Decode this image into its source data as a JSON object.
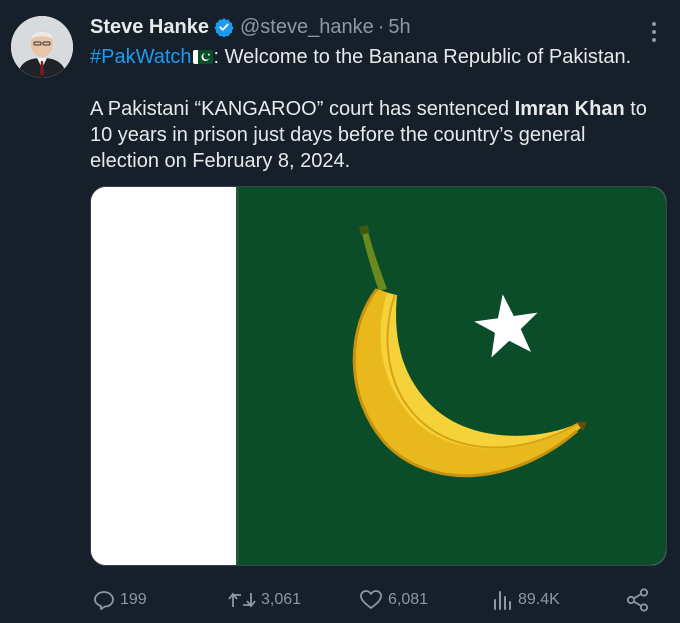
{
  "author": {
    "display_name": "Steve Hanke",
    "handle": "@steve_hanke",
    "separator": "·",
    "time_ago": "5h",
    "verified": true,
    "verified_color": "#1d9bf0"
  },
  "tweet": {
    "hashtag": "#PakWatch",
    "line1_after_flag": ": Welcome to the Banana Republic of Pakistan.",
    "line2_a": "A Pakistani “KANGAROO” court has sentenced ",
    "line2_bold": "Imran Khan",
    "line2_b": " to",
    "line3": "10 years in prison just days before the country’s general",
    "line4": "election on February 8, 2024.",
    "flag_emoji": "pakistan-flag"
  },
  "actions": {
    "replies": "199",
    "reposts": "3,061",
    "likes": "6,081",
    "views": "89.4K"
  },
  "colors": {
    "background": "#15202b",
    "text": "#e7e9ea",
    "muted": "#8b98a5",
    "link": "#1d9bf0",
    "flag_green": "#0b4d28"
  }
}
